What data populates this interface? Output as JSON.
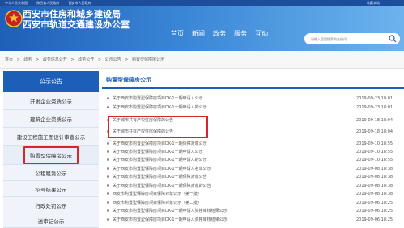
{
  "topbar": {
    "links": [
      "中华人民共和国",
      "陕西省人民政府",
      "西安市人民政府"
    ],
    "favorite": "收藏本站"
  },
  "header": {
    "title_line1": "西安市住房和城乡建设局",
    "title_line2": "西安市轨道交通建设办公室",
    "nav": [
      "首页",
      "新闻",
      "政务",
      "服务",
      "互动"
    ],
    "search_placeholder": "请输入您要搜索的关键词"
  },
  "breadcrumb": [
    "首页",
    ">",
    "政务",
    ">",
    "政务信息公开",
    ">",
    "政务公开",
    ">",
    "公示公告",
    ">",
    "购置型保障房公示"
  ],
  "sidebar": {
    "heading": "公示公告",
    "items": [
      "开发企业资质公示",
      "建筑企业资质公示",
      "建设工程施工图设计审查公示",
      "购置型保障房公示",
      "公租租赁公示",
      "招号结果公示",
      "行政处罚公示",
      "送审记公示"
    ]
  },
  "content": {
    "title": "购置型保障房公示",
    "rows": [
      {
        "title": "关于西安市购置型保障房项目DK-1一期申请人公示",
        "date": "2019-09-23 18:01"
      },
      {
        "title": "关于西安市购置型保障房项目DK-1一期申请人的公示",
        "date": "2019-09-23 18:01"
      },
      {
        "title": "关于城市共有产权住房保障的公告",
        "date": "2019-09-18 18:04"
      },
      {
        "title": "关于城市共有产权住房保障的公告",
        "date": "2019-09-18 18:04"
      },
      {
        "title": "关于西安市购置型保障房项目DK-1一期保障对象公示",
        "date": "2019-09-10 18:55"
      },
      {
        "title": "关于西安市购置型保障房项目DK-1一期申请人公示",
        "date": "2019-09-10 18:55"
      },
      {
        "title": "关于西安市购置型保障房项目DK-1一期申请人的公示",
        "date": "2019-09-10 18:55"
      },
      {
        "title": "关于西安市购置型保障房项目DK-1一期申请人名单公示",
        "date": "2019-09-08 18:38"
      },
      {
        "title": "关于西安市购置型保障房项目DK-1一期保障对象公告",
        "date": "2019-09-08 18:38"
      },
      {
        "title": "关于西安市购置型保障房项目DK-1一期保障对象的公告",
        "date": "2019-09-08 18:38"
      },
      {
        "title": "西安市购置型保障房项目保障对象公示（第一批）",
        "date": "2019-09-08 18:38"
      },
      {
        "title": "西安市购置型保障房项目保障对象公示（第二批）",
        "date": "2019-09-06 18:25"
      },
      {
        "title": "关于西安市购置型保障房项目DK-1一期申请人资格审核结果公示",
        "date": "2019-09-06 18:25"
      },
      {
        "title": "关于西安市购置型保障房项目DK-1一期申请人资格审核结果公示",
        "date": "2019-09-06 18:25"
      }
    ]
  },
  "colors": {
    "brand": "#1d5fb8",
    "highlight": "#d6262a"
  }
}
